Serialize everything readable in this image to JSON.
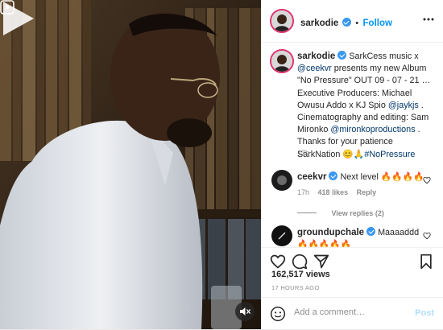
{
  "post": {
    "author": "sarkodie",
    "follow_separator": "•",
    "follow_label": "Follow",
    "caption_author": "sarkodie",
    "caption_1": "SarkCess music x",
    "caption_mention_1": "@ceekvr",
    "caption_2": " presents my new Album \"No Pressure\" OUT 09 - 07 - 21 … Executive Producers: Michael Owusu Addo x KJ Spio ",
    "caption_mention_2": "@jaykjs",
    "caption_3": " . Cinematography and editing: Sam Mironko ",
    "caption_mention_3": "@mironkoproductions",
    "caption_4": " . Thanks for your patience SarkNation ",
    "caption_emoji": "😊🙏",
    "caption_hashtag": "#NoPressure",
    "caption_time": "17h"
  },
  "comments": [
    {
      "author": "ceekvr",
      "text": "Next level",
      "emoji": "🔥🔥🔥🔥",
      "time": "17h",
      "likes": "418 likes",
      "reply": "Reply",
      "view_replies": "View replies (2)"
    },
    {
      "author": "groundupchale",
      "text": "Maaaaddd",
      "emoji": "🔥🔥🔥🔥🔥"
    }
  ],
  "stats": {
    "views": "162,517 views",
    "time_ago": "17 HOURS AGO"
  },
  "composer": {
    "placeholder": "Add a comment…",
    "post_label": "Post"
  },
  "colors": {
    "accent": "#0095f6",
    "verified": "#3897f0",
    "link": "#00376b",
    "muted": "#8e8e8e"
  }
}
